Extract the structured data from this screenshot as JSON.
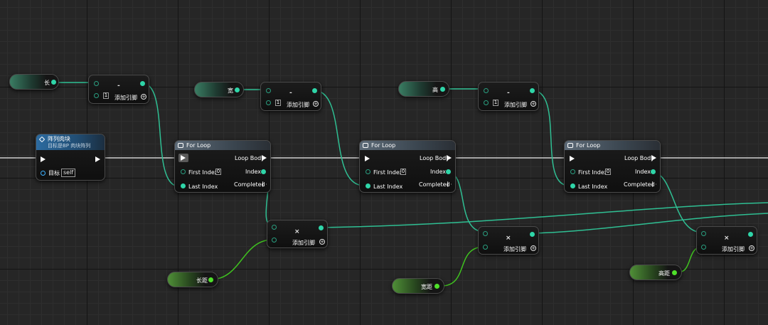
{
  "variables": {
    "length": "长",
    "width": "宽",
    "height": "高",
    "length_spacing": "长距",
    "width_spacing": "宽距",
    "height_spacing": "高距"
  },
  "function_node": {
    "title": "阵列肉块",
    "subtitle": "目标是BP 肉块阵列",
    "target_label": "目标",
    "target_value": "self"
  },
  "subtract_node": {
    "operator": "-",
    "b_value": "1",
    "add_pin_label": "添加引脚"
  },
  "multiply_node": {
    "operator": "×",
    "add_pin_label": "添加引脚"
  },
  "for_loop": {
    "title": "For Loop",
    "loop_body": "Loop Body",
    "first_index": "First Index",
    "first_index_value": "0",
    "last_index": "Last Index",
    "index": "Index",
    "completed": "Completed"
  },
  "colors": {
    "float_pin": "#2fd5a8",
    "int_pin": "#4fe02a",
    "exec_wire": "#d8d8d8",
    "loop_header": "#5d6b78",
    "function_header": "#2c6ba0"
  }
}
